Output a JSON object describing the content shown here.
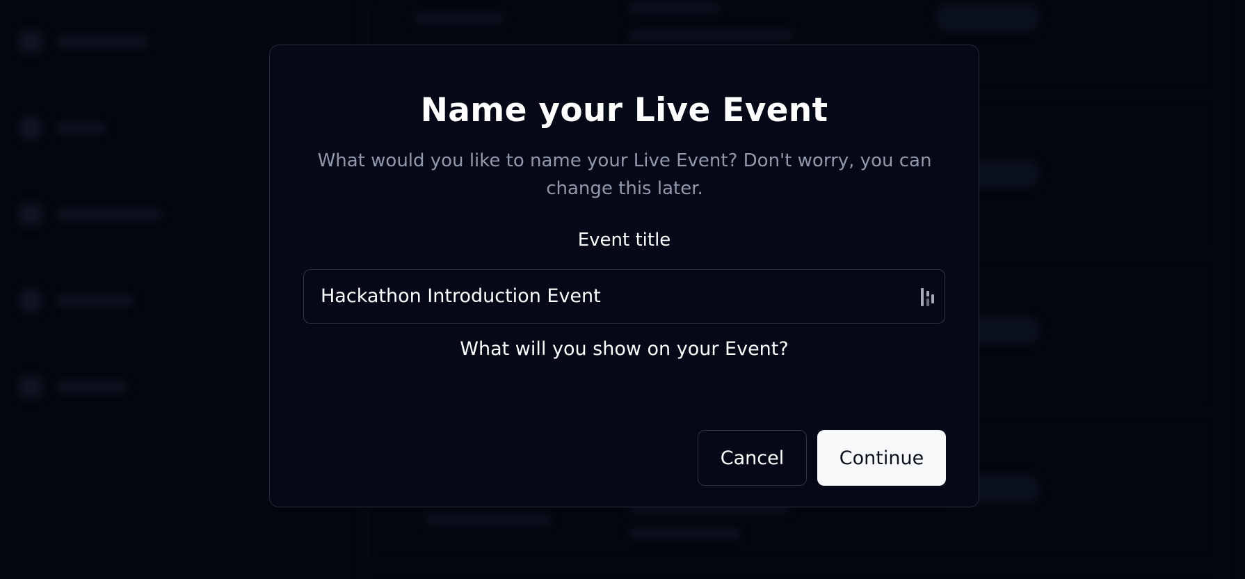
{
  "dialog": {
    "title": "Name your Live Event",
    "subtitle": "What would you like to name your Live Event? Don't worry, you can change this later.",
    "field_label": "Event title",
    "input_value": "Hackathon Introduction Event",
    "input_icon": "password-manager-extension-icon",
    "question": "What will you show on your Event?",
    "cancel_label": "Cancel",
    "continue_label": "Continue"
  },
  "colors": {
    "background": "#04060f",
    "modal_background": "#050816",
    "modal_border": "#262b3a",
    "subtitle_text": "#9299ab",
    "primary_button": "#f8f9fb",
    "primary_button_text": "#0b0f1c"
  }
}
